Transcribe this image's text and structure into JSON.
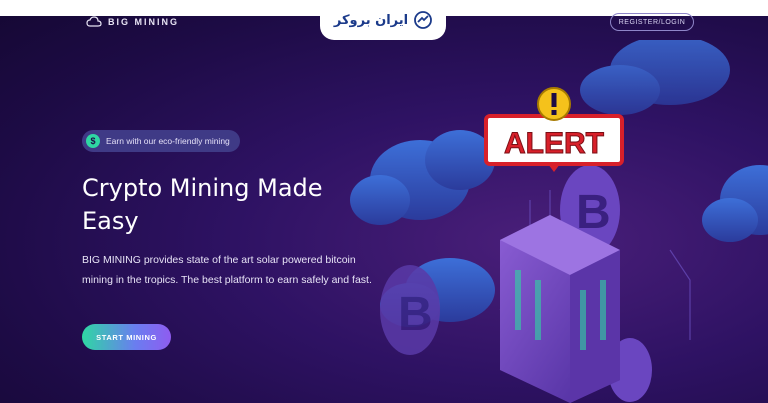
{
  "header": {
    "logo_text": "BIG MINING",
    "brand_text": "ایران بروکر",
    "register_label": "REGISTER/LOGIN"
  },
  "hero": {
    "badge_text": "Earn with our eco-friendly mining",
    "badge_icon": "dollar-icon",
    "title": "Crypto Mining Made Easy",
    "description": "BIG MINING provides state of the art solar powered bitcoin mining in the tropics. The best platform to earn safely and fast.",
    "cta_label": "START MINING"
  },
  "illustration": {
    "alert_text": "ALERT",
    "alert_icon": "exclamation-icon",
    "coin_symbol": "B"
  },
  "colors": {
    "accent_green": "#2fd7a3",
    "accent_purple": "#8f5cf0",
    "alert_red": "#d8202a",
    "alert_yellow": "#f5c21b"
  }
}
